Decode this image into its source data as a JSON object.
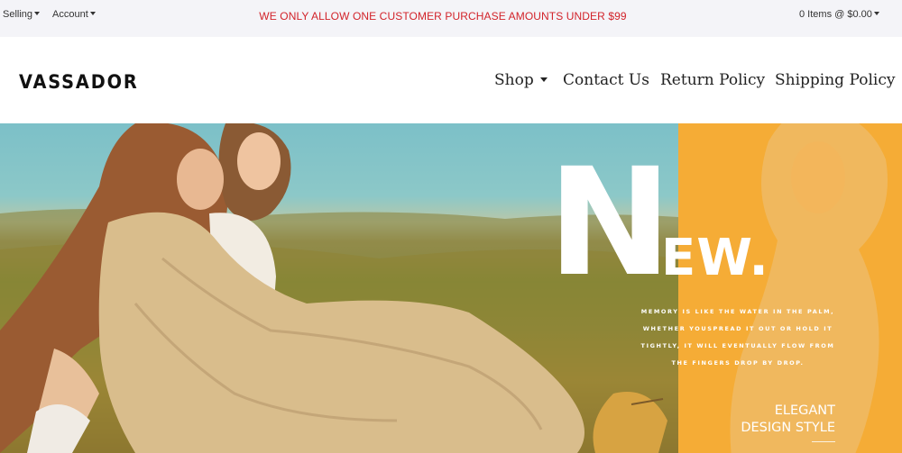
{
  "topbar": {
    "selling": "Selling",
    "account": "Account",
    "notice": "WE ONLY ALLOW ONE CUSTOMER PURCHASE AMOUNTS UNDER $99",
    "cart": "0 Items @ $0.00"
  },
  "header": {
    "logo": "VASSADOR",
    "nav": [
      "Shop",
      "Contact Us",
      "Return Policy",
      "Shipping Policy"
    ]
  },
  "hero": {
    "big_letter": "N",
    "big_rest": "EW.",
    "quote_lines": [
      "MEMORY IS LIKE THE WATER IN THE PALM,",
      "WHETHER YOUSPREAD IT OUT OR HOLD IT",
      "TIGHTLY, IT WILL EVENTUALLY FLOW FROM",
      "THE FINGERS DROP BY DROP."
    ],
    "tagline_1": "ELEGANT",
    "tagline_2": "DESIGN STYLE"
  },
  "colors": {
    "notice": "#d2232a",
    "accent_panel": "#f5ac36",
    "topbar_bg": "#f4f4f8"
  },
  "icons": [
    "caret-down-icon"
  ]
}
